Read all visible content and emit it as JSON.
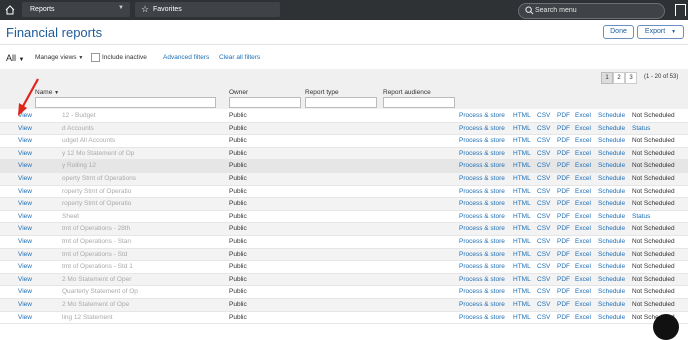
{
  "topbar": {
    "nav_label": "Reports",
    "favorites_label": "Favorites",
    "search_placeholder": "Search menu",
    "icons": [
      "home-icon",
      "chevron-down-icon",
      "star-icon",
      "search-icon",
      "bookmark-icon"
    ]
  },
  "header": {
    "title": "Financial reports",
    "done_label": "Done",
    "export_label": "Export"
  },
  "filters": {
    "view_label": "All",
    "manage_views_label": "Manage views",
    "include_inactive_label": "Include inactive",
    "advanced_filters_label": "Advanced filters",
    "clear_filters_label": "Clear all filters"
  },
  "pagination": {
    "pages": [
      "1",
      "2",
      "3"
    ],
    "current": "1",
    "info": "(1 - 20 of 53)"
  },
  "table": {
    "headers": {
      "name": "Name",
      "owner": "Owner",
      "report_type": "Report type",
      "report_audience": "Report audience"
    },
    "rows": [
      {
        "view": "View",
        "name": "12 - Budget",
        "owner": "Public",
        "process": "Process & store",
        "html": "HTML",
        "csv": "CSV",
        "pdf": "PDF",
        "excel": "Excel",
        "schedule": "Schedule",
        "status": "Not Scheduled"
      },
      {
        "view": "View",
        "name": "d Accounts",
        "owner": "Public",
        "process": "Process & store",
        "html": "HTML",
        "csv": "CSV",
        "pdf": "PDF",
        "excel": "Excel",
        "schedule": "Schedule",
        "status": "Status"
      },
      {
        "view": "View",
        "name": "udget All Accounts",
        "owner": "Public",
        "process": "Process & store",
        "html": "HTML",
        "csv": "CSV",
        "pdf": "PDF",
        "excel": "Excel",
        "schedule": "Schedule",
        "status": "Not Scheduled"
      },
      {
        "view": "View",
        "name": "y 12 Mo Statement of Op",
        "owner": "Public",
        "process": "Process & store",
        "html": "HTML",
        "csv": "CSV",
        "pdf": "PDF",
        "excel": "Excel",
        "schedule": "Schedule",
        "status": "Not Scheduled"
      },
      {
        "view": "View",
        "name": "y Rolling 12",
        "owner": "Public",
        "process": "Process & store",
        "html": "HTML",
        "csv": "CSV",
        "pdf": "PDF",
        "excel": "Excel",
        "schedule": "Schedule",
        "status": "Not Scheduled"
      },
      {
        "view": "View",
        "name": "operty Stmt of Operations",
        "owner": "Public",
        "process": "Process & store",
        "html": "HTML",
        "csv": "CSV",
        "pdf": "PDF",
        "excel": "Excel",
        "schedule": "Schedule",
        "status": "Not Scheduled"
      },
      {
        "view": "View",
        "name": "roperty Stmt of Operatio",
        "owner": "Public",
        "process": "Process & store",
        "html": "HTML",
        "csv": "CSV",
        "pdf": "PDF",
        "excel": "Excel",
        "schedule": "Schedule",
        "status": "Not Scheduled"
      },
      {
        "view": "View",
        "name": "roperty Stmt of Operatio",
        "owner": "Public",
        "process": "Process & store",
        "html": "HTML",
        "csv": "CSV",
        "pdf": "PDF",
        "excel": "Excel",
        "schedule": "Schedule",
        "status": "Not Scheduled"
      },
      {
        "view": "View",
        "name": "Sheet",
        "owner": "Public",
        "process": "Process & store",
        "html": "HTML",
        "csv": "CSV",
        "pdf": "PDF",
        "excel": "Excel",
        "schedule": "Schedule",
        "status": "Status"
      },
      {
        "view": "View",
        "name": "tmt of Operations - 28th",
        "owner": "Public",
        "process": "Process & store",
        "html": "HTML",
        "csv": "CSV",
        "pdf": "PDF",
        "excel": "Excel",
        "schedule": "Schedule",
        "status": "Not Scheduled"
      },
      {
        "view": "View",
        "name": "tmt of Operations - Stan",
        "owner": "Public",
        "process": "Process & store",
        "html": "HTML",
        "csv": "CSV",
        "pdf": "PDF",
        "excel": "Excel",
        "schedule": "Schedule",
        "status": "Not Scheduled"
      },
      {
        "view": "View",
        "name": "tmt of Operations - Std",
        "owner": "Public",
        "process": "Process & store",
        "html": "HTML",
        "csv": "CSV",
        "pdf": "PDF",
        "excel": "Excel",
        "schedule": "Schedule",
        "status": "Not Scheduled"
      },
      {
        "view": "View",
        "name": "tmt of Operations - Std 1",
        "owner": "Public",
        "process": "Process & store",
        "html": "HTML",
        "csv": "CSV",
        "pdf": "PDF",
        "excel": "Excel",
        "schedule": "Schedule",
        "status": "Not Scheduled"
      },
      {
        "view": "View",
        "name": "2 Mo Statement of Oper",
        "owner": "Public",
        "process": "Process & store",
        "html": "HTML",
        "csv": "CSV",
        "pdf": "PDF",
        "excel": "Excel",
        "schedule": "Schedule",
        "status": "Not Scheduled"
      },
      {
        "view": "View",
        "name": "Quarterly Statement of Op",
        "owner": "Public",
        "process": "Process & store",
        "html": "HTML",
        "csv": "CSV",
        "pdf": "PDF",
        "excel": "Excel",
        "schedule": "Schedule",
        "status": "Not Scheduled"
      },
      {
        "view": "View",
        "name": "2 Mo Statement of Ope",
        "owner": "Public",
        "process": "Process & store",
        "html": "HTML",
        "csv": "CSV",
        "pdf": "PDF",
        "excel": "Excel",
        "schedule": "Schedule",
        "status": "Not Scheduled"
      },
      {
        "view": "View",
        "name": "ling 12 Statement",
        "owner": "Public",
        "process": "Process & store",
        "html": "HTML",
        "csv": "CSV",
        "pdf": "PDF",
        "excel": "Excel",
        "schedule": "Schedule",
        "status": "Not Scheduled"
      }
    ]
  },
  "colors": {
    "topbar": "#2f3235",
    "title": "#1f5c99",
    "link": "#1f6fb5",
    "annotation_arrow": "#e0241b"
  }
}
